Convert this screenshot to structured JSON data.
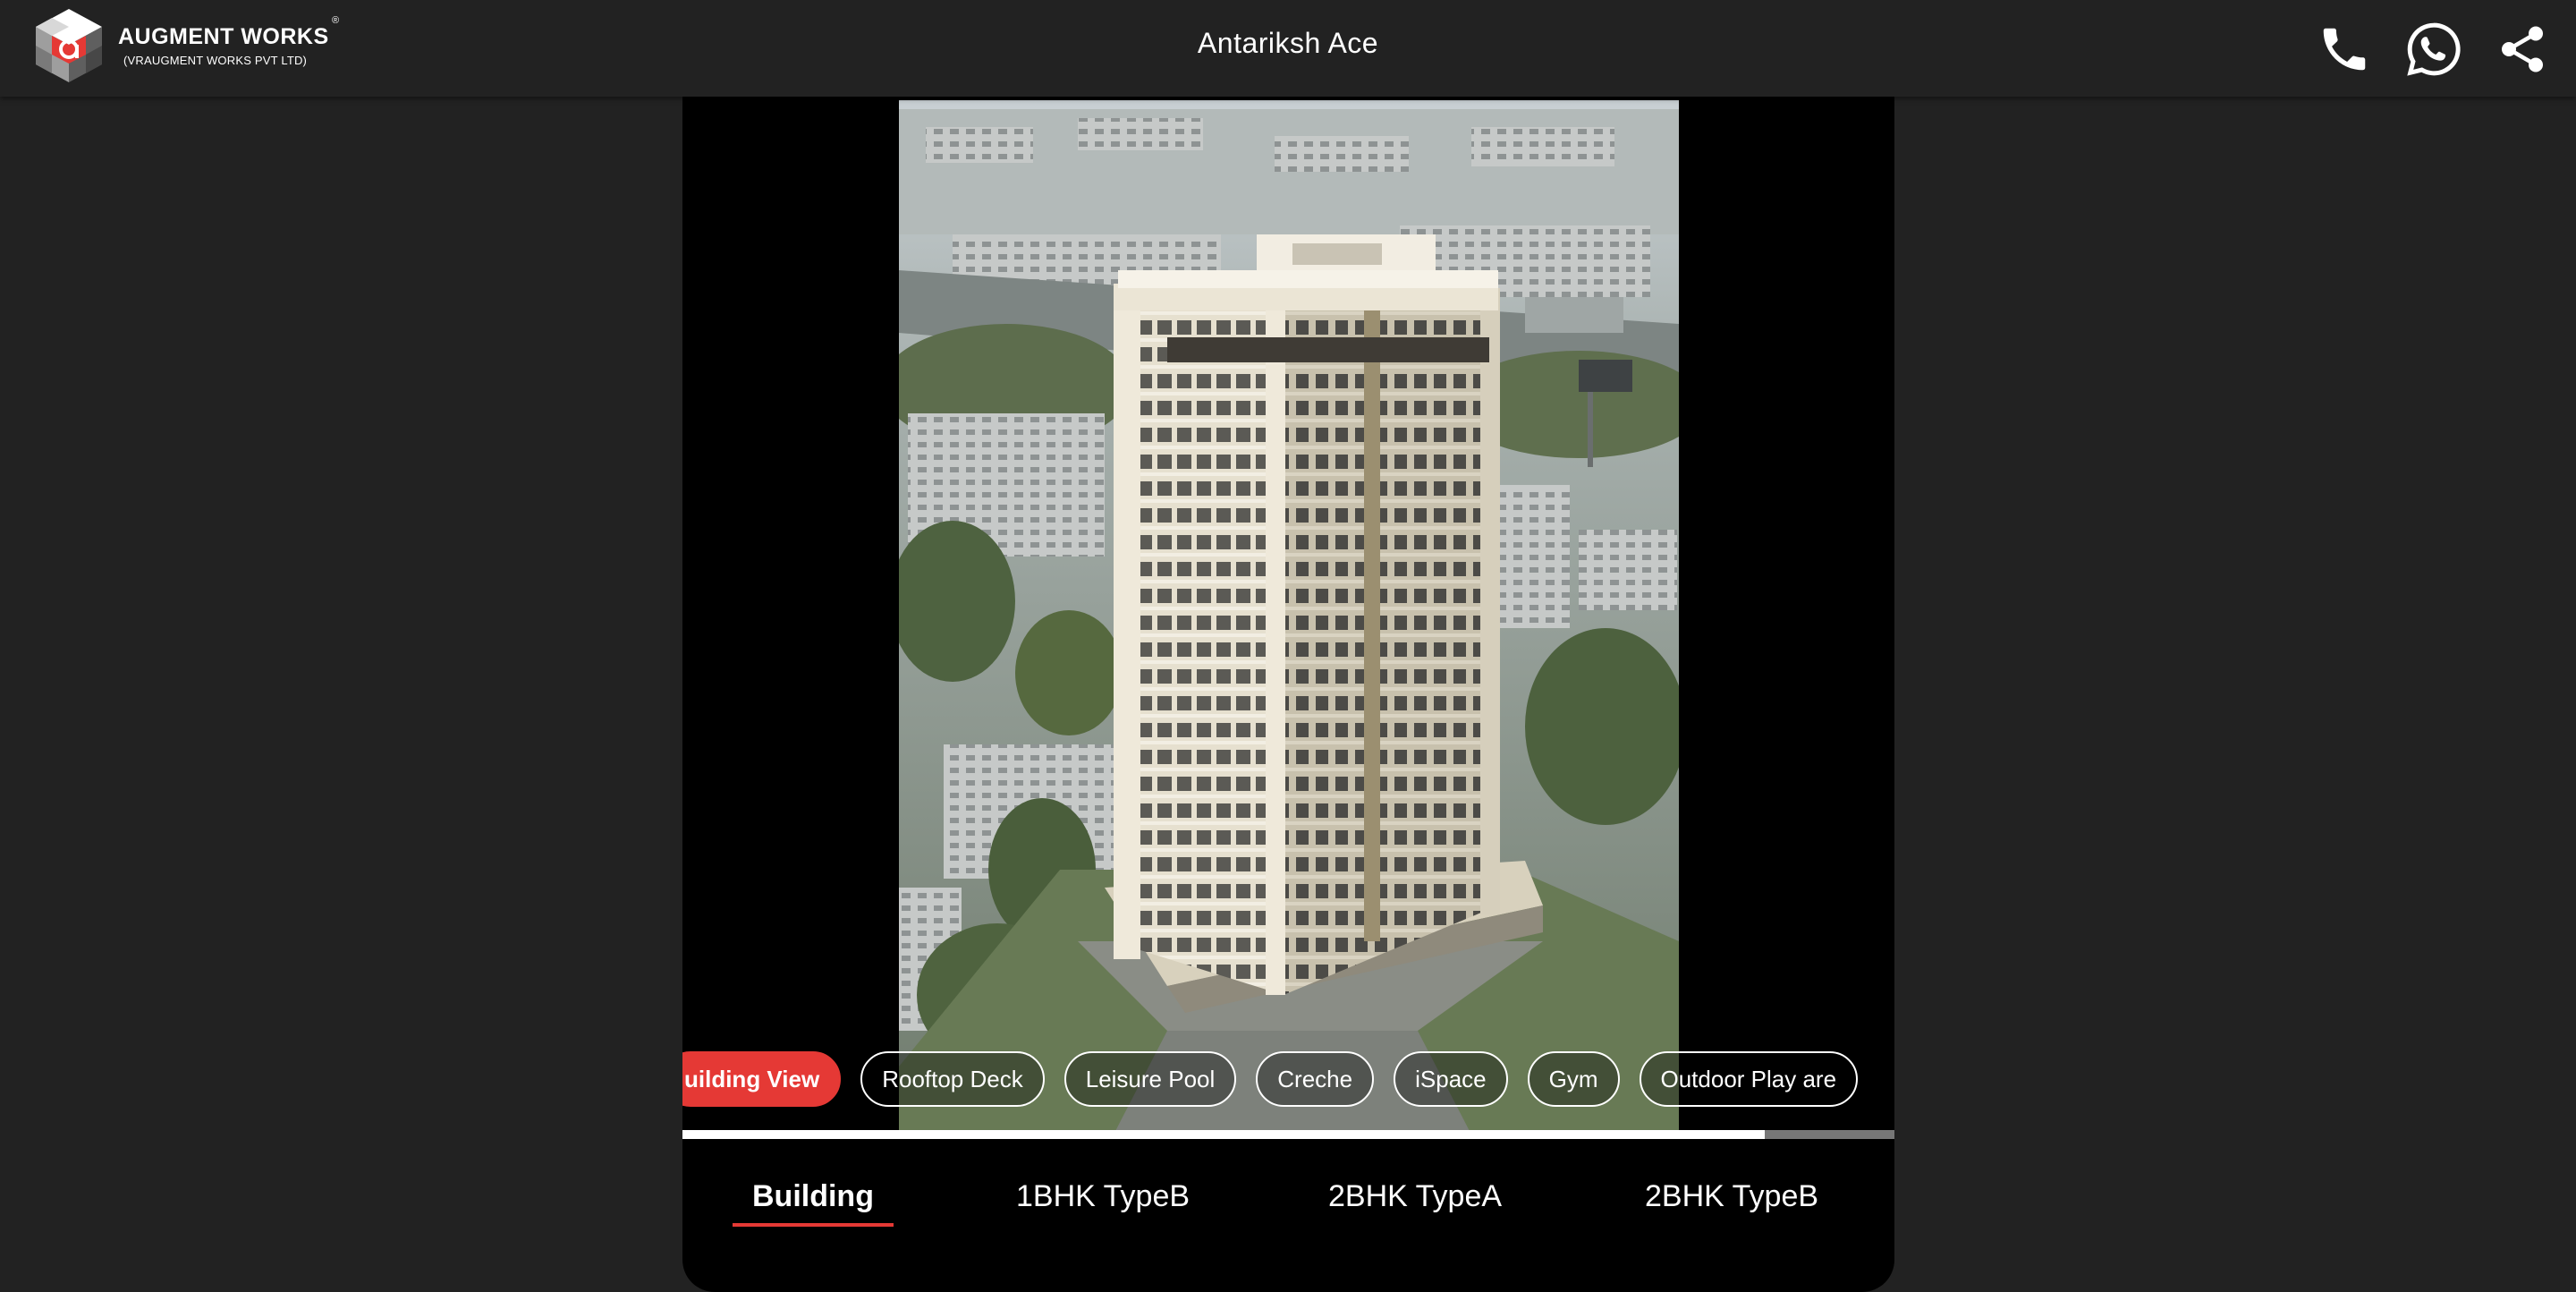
{
  "header": {
    "brand_name": "AUGMENT WORKS",
    "brand_reg": "®",
    "brand_sub": "(VRAUGMENT WORKS PVT LTD)",
    "title": "Antariksh Ace",
    "icons": [
      "phone-icon",
      "whatsapp-icon",
      "share-icon"
    ]
  },
  "chips": [
    {
      "label": "uilding View",
      "active": true
    },
    {
      "label": "Rooftop Deck",
      "active": false
    },
    {
      "label": "Leisure Pool",
      "active": false
    },
    {
      "label": "Creche",
      "active": false
    },
    {
      "label": "iSpace",
      "active": false
    },
    {
      "label": "Gym",
      "active": false
    },
    {
      "label": "Outdoor Play are",
      "active": false
    }
  ],
  "progress": {
    "fraction": 0.893
  },
  "tabs": [
    {
      "label": "Building",
      "active": true
    },
    {
      "label": "1BHK TypeB",
      "active": false
    },
    {
      "label": "2BHK TypeA",
      "active": false
    },
    {
      "label": "2BHK TypeB",
      "active": false
    }
  ],
  "colors": {
    "accent": "#e53935",
    "background": "#222222",
    "viewer": "#000000"
  }
}
